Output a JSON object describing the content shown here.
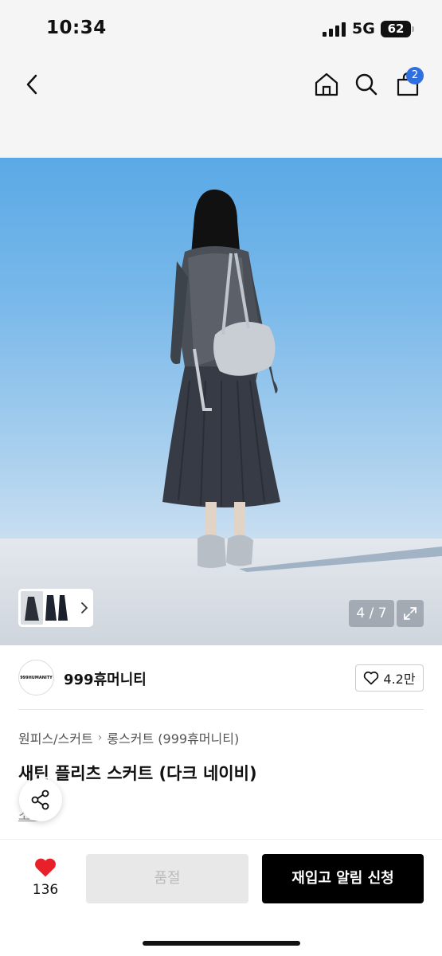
{
  "status_bar": {
    "time": "10:34",
    "network": "5G",
    "battery": "62"
  },
  "nav": {
    "cart_count": "2"
  },
  "hero": {
    "counter": "4 / 7"
  },
  "brand": {
    "name": "999휴머니티",
    "logo_text": "999HUMANITY",
    "likes": "4.2만"
  },
  "breadcrumb": {
    "category": "원피스/스커트",
    "subcategory": "롱스커트 (999휴머니티)"
  },
  "product": {
    "title": "새틴 플리츠 스커트 (다크 네이비)",
    "sub_link": "소개"
  },
  "bottom_bar": {
    "wish_count": "136",
    "soldout_label": "품절",
    "restock_label": "재입고 알림 신청"
  },
  "colors": {
    "accent_badge": "#2f6fe0",
    "heart": "#e8202a",
    "primary_button": "#000000"
  },
  "icons": [
    "chevron-left-icon",
    "home-icon",
    "search-icon",
    "cart-icon",
    "expand-icon",
    "heart-outline-icon",
    "share-icon",
    "heart-filled-icon",
    "chevron-right-icon"
  ]
}
